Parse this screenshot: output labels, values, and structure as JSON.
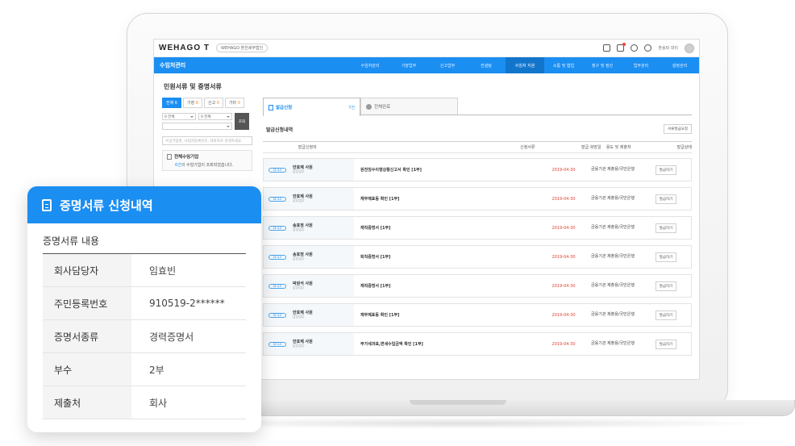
{
  "brand": {
    "logo_text": "WEHAGO T",
    "accent": "#1b8ef2"
  },
  "topbar": {
    "company": "WEHAGO 혼천세무법인",
    "user": "혼송파 대리"
  },
  "nav": {
    "title": "수임처관리",
    "items": [
      "수임처관리",
      "기장업무",
      "신고업무",
      "컨설팅",
      "수임처 지원",
      "소통 및 협업",
      "청구 및 정산",
      "업무관리",
      "설정관리"
    ],
    "active_index": 4
  },
  "page": {
    "title": "민원서류 및 증명서류"
  },
  "left": {
    "tabs": [
      {
        "label": "전체",
        "count": "6"
      },
      {
        "label": "기장",
        "count": "6"
      },
      {
        "label": "신고",
        "count": "0"
      },
      {
        "label": "기타",
        "count": "0"
      }
    ],
    "filter1": "0 전체",
    "filter2": "0 전체",
    "filter3": "",
    "search_button": "조회",
    "search_placeholder": "수임기업명, 사업자등록번호, 대표자로 검색하세요.",
    "all_companies": {
      "label": "전체수임기업",
      "count_text": "6건",
      "desc": "의 수임기업이 조회되었습니다."
    }
  },
  "right": {
    "tabs": [
      {
        "label": "발급신청",
        "count": "7건"
      },
      {
        "label": "전체완료",
        "count": ""
      }
    ],
    "section_title": "발급신청내역",
    "register_button": "서류발급요청",
    "headers": [
      "발급신청자",
      "신청서류",
      "발급 희망일",
      "용도 및 제출처",
      "발급상태"
    ],
    "rows": [
      {
        "badge": "D-13",
        "name": "안효제 사원",
        "sub": "담당업무",
        "doc": "원천징수이행상황신고서 확인 [1부]",
        "date": "2019-04-30",
        "purpose": "금융기관 제출용/국민은행",
        "status": "발급하기"
      },
      {
        "badge": "D-13",
        "name": "안효제 사원",
        "sub": "담당업무",
        "doc": "재무제표등 확인 [1부]",
        "date": "2019-04-30",
        "purpose": "금융기관 제출용/국민은행",
        "status": "발급하기"
      },
      {
        "badge": "D-13",
        "name": "송효정 사원",
        "sub": "담당업무",
        "doc": "재직증명서 [1부]",
        "date": "2019-04-30",
        "purpose": "금융기관 제출용/국민은행",
        "status": "발급하기"
      },
      {
        "badge": "D-13",
        "name": "송효정 사원",
        "sub": "담당업무",
        "doc": "퇴직증명서 [1부]",
        "date": "2019-04-30",
        "purpose": "금융기관 제출용/국민은행",
        "status": "발급하기"
      },
      {
        "badge": "D-13",
        "name": "박원석 사원",
        "sub": "담당업무",
        "doc": "재직증명서 [1부]",
        "date": "2019-04-30",
        "purpose": "금융기관 제출용/국민은행",
        "status": "발급하기"
      },
      {
        "badge": "D-13",
        "name": "안효제 사원",
        "sub": "담당업무",
        "doc": "재무제표등 확인 [1부]",
        "date": "2019-04-30",
        "purpose": "금융기관 제출용/국민은행",
        "status": "발급하기"
      },
      {
        "badge": "D-13",
        "name": "안효제 사원",
        "sub": "담당업무",
        "doc": "부가세과표,면세수입금액 확인 [1부]",
        "date": "2019-04-30",
        "purpose": "금융기관 제출용/국민은행",
        "status": "발급하기"
      }
    ]
  },
  "card": {
    "title": "증명서류 신청내역",
    "subtitle": "증명서류 내용",
    "rows": [
      {
        "k": "회사담당자",
        "v": "임효빈"
      },
      {
        "k": "주민등록번호",
        "v": "910519-2******"
      },
      {
        "k": "증명서종류",
        "v": "경력증명서"
      },
      {
        "k": "부수",
        "v": "2부"
      },
      {
        "k": "제출처",
        "v": "회사"
      }
    ]
  }
}
